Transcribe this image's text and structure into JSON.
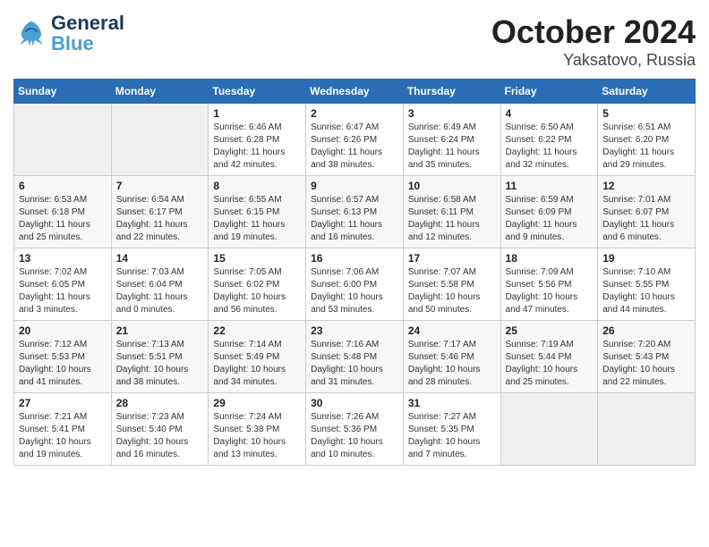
{
  "header": {
    "logo_general": "General",
    "logo_blue": "Blue",
    "title": "October 2024",
    "subtitle": "Yaksatovo, Russia"
  },
  "days_of_week": [
    "Sunday",
    "Monday",
    "Tuesday",
    "Wednesday",
    "Thursday",
    "Friday",
    "Saturday"
  ],
  "weeks": [
    [
      {
        "day": "",
        "sunrise": "",
        "sunset": "",
        "daylight": ""
      },
      {
        "day": "",
        "sunrise": "",
        "sunset": "",
        "daylight": ""
      },
      {
        "day": "1",
        "sunrise": "Sunrise: 6:46 AM",
        "sunset": "Sunset: 6:28 PM",
        "daylight": "Daylight: 11 hours and 42 minutes."
      },
      {
        "day": "2",
        "sunrise": "Sunrise: 6:47 AM",
        "sunset": "Sunset: 6:26 PM",
        "daylight": "Daylight: 11 hours and 38 minutes."
      },
      {
        "day": "3",
        "sunrise": "Sunrise: 6:49 AM",
        "sunset": "Sunset: 6:24 PM",
        "daylight": "Daylight: 11 hours and 35 minutes."
      },
      {
        "day": "4",
        "sunrise": "Sunrise: 6:50 AM",
        "sunset": "Sunset: 6:22 PM",
        "daylight": "Daylight: 11 hours and 32 minutes."
      },
      {
        "day": "5",
        "sunrise": "Sunrise: 6:51 AM",
        "sunset": "Sunset: 6:20 PM",
        "daylight": "Daylight: 11 hours and 29 minutes."
      }
    ],
    [
      {
        "day": "6",
        "sunrise": "Sunrise: 6:53 AM",
        "sunset": "Sunset: 6:18 PM",
        "daylight": "Daylight: 11 hours and 25 minutes."
      },
      {
        "day": "7",
        "sunrise": "Sunrise: 6:54 AM",
        "sunset": "Sunset: 6:17 PM",
        "daylight": "Daylight: 11 hours and 22 minutes."
      },
      {
        "day": "8",
        "sunrise": "Sunrise: 6:55 AM",
        "sunset": "Sunset: 6:15 PM",
        "daylight": "Daylight: 11 hours and 19 minutes."
      },
      {
        "day": "9",
        "sunrise": "Sunrise: 6:57 AM",
        "sunset": "Sunset: 6:13 PM",
        "daylight": "Daylight: 11 hours and 16 minutes."
      },
      {
        "day": "10",
        "sunrise": "Sunrise: 6:58 AM",
        "sunset": "Sunset: 6:11 PM",
        "daylight": "Daylight: 11 hours and 12 minutes."
      },
      {
        "day": "11",
        "sunrise": "Sunrise: 6:59 AM",
        "sunset": "Sunset: 6:09 PM",
        "daylight": "Daylight: 11 hours and 9 minutes."
      },
      {
        "day": "12",
        "sunrise": "Sunrise: 7:01 AM",
        "sunset": "Sunset: 6:07 PM",
        "daylight": "Daylight: 11 hours and 6 minutes."
      }
    ],
    [
      {
        "day": "13",
        "sunrise": "Sunrise: 7:02 AM",
        "sunset": "Sunset: 6:05 PM",
        "daylight": "Daylight: 11 hours and 3 minutes."
      },
      {
        "day": "14",
        "sunrise": "Sunrise: 7:03 AM",
        "sunset": "Sunset: 6:04 PM",
        "daylight": "Daylight: 11 hours and 0 minutes."
      },
      {
        "day": "15",
        "sunrise": "Sunrise: 7:05 AM",
        "sunset": "Sunset: 6:02 PM",
        "daylight": "Daylight: 10 hours and 56 minutes."
      },
      {
        "day": "16",
        "sunrise": "Sunrise: 7:06 AM",
        "sunset": "Sunset: 6:00 PM",
        "daylight": "Daylight: 10 hours and 53 minutes."
      },
      {
        "day": "17",
        "sunrise": "Sunrise: 7:07 AM",
        "sunset": "Sunset: 5:58 PM",
        "daylight": "Daylight: 10 hours and 50 minutes."
      },
      {
        "day": "18",
        "sunrise": "Sunrise: 7:09 AM",
        "sunset": "Sunset: 5:56 PM",
        "daylight": "Daylight: 10 hours and 47 minutes."
      },
      {
        "day": "19",
        "sunrise": "Sunrise: 7:10 AM",
        "sunset": "Sunset: 5:55 PM",
        "daylight": "Daylight: 10 hours and 44 minutes."
      }
    ],
    [
      {
        "day": "20",
        "sunrise": "Sunrise: 7:12 AM",
        "sunset": "Sunset: 5:53 PM",
        "daylight": "Daylight: 10 hours and 41 minutes."
      },
      {
        "day": "21",
        "sunrise": "Sunrise: 7:13 AM",
        "sunset": "Sunset: 5:51 PM",
        "daylight": "Daylight: 10 hours and 38 minutes."
      },
      {
        "day": "22",
        "sunrise": "Sunrise: 7:14 AM",
        "sunset": "Sunset: 5:49 PM",
        "daylight": "Daylight: 10 hours and 34 minutes."
      },
      {
        "day": "23",
        "sunrise": "Sunrise: 7:16 AM",
        "sunset": "Sunset: 5:48 PM",
        "daylight": "Daylight: 10 hours and 31 minutes."
      },
      {
        "day": "24",
        "sunrise": "Sunrise: 7:17 AM",
        "sunset": "Sunset: 5:46 PM",
        "daylight": "Daylight: 10 hours and 28 minutes."
      },
      {
        "day": "25",
        "sunrise": "Sunrise: 7:19 AM",
        "sunset": "Sunset: 5:44 PM",
        "daylight": "Daylight: 10 hours and 25 minutes."
      },
      {
        "day": "26",
        "sunrise": "Sunrise: 7:20 AM",
        "sunset": "Sunset: 5:43 PM",
        "daylight": "Daylight: 10 hours and 22 minutes."
      }
    ],
    [
      {
        "day": "27",
        "sunrise": "Sunrise: 7:21 AM",
        "sunset": "Sunset: 5:41 PM",
        "daylight": "Daylight: 10 hours and 19 minutes."
      },
      {
        "day": "28",
        "sunrise": "Sunrise: 7:23 AM",
        "sunset": "Sunset: 5:40 PM",
        "daylight": "Daylight: 10 hours and 16 minutes."
      },
      {
        "day": "29",
        "sunrise": "Sunrise: 7:24 AM",
        "sunset": "Sunset: 5:38 PM",
        "daylight": "Daylight: 10 hours and 13 minutes."
      },
      {
        "day": "30",
        "sunrise": "Sunrise: 7:26 AM",
        "sunset": "Sunset: 5:36 PM",
        "daylight": "Daylight: 10 hours and 10 minutes."
      },
      {
        "day": "31",
        "sunrise": "Sunrise: 7:27 AM",
        "sunset": "Sunset: 5:35 PM",
        "daylight": "Daylight: 10 hours and 7 minutes."
      },
      {
        "day": "",
        "sunrise": "",
        "sunset": "",
        "daylight": ""
      },
      {
        "day": "",
        "sunrise": "",
        "sunset": "",
        "daylight": ""
      }
    ]
  ]
}
